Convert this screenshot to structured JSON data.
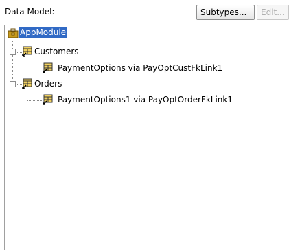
{
  "header": {
    "label": "Data Model:",
    "subtypes_button": "Subtypes...",
    "edit_button": "Edit..."
  },
  "tree": {
    "root": {
      "label": "AppModule",
      "icon": "app-module-icon",
      "selected": true
    },
    "nodes": [
      {
        "label": "Customers",
        "icon": "view-object-icon",
        "expanded": true
      },
      {
        "label": "PaymentOptions via PayOptCustFkLink1",
        "icon": "view-object-icon"
      },
      {
        "label": "Orders",
        "icon": "view-object-icon",
        "expanded": true
      },
      {
        "label": "PaymentOptions1 via PayOptOrderFkLink1",
        "icon": "view-object-icon"
      }
    ]
  }
}
